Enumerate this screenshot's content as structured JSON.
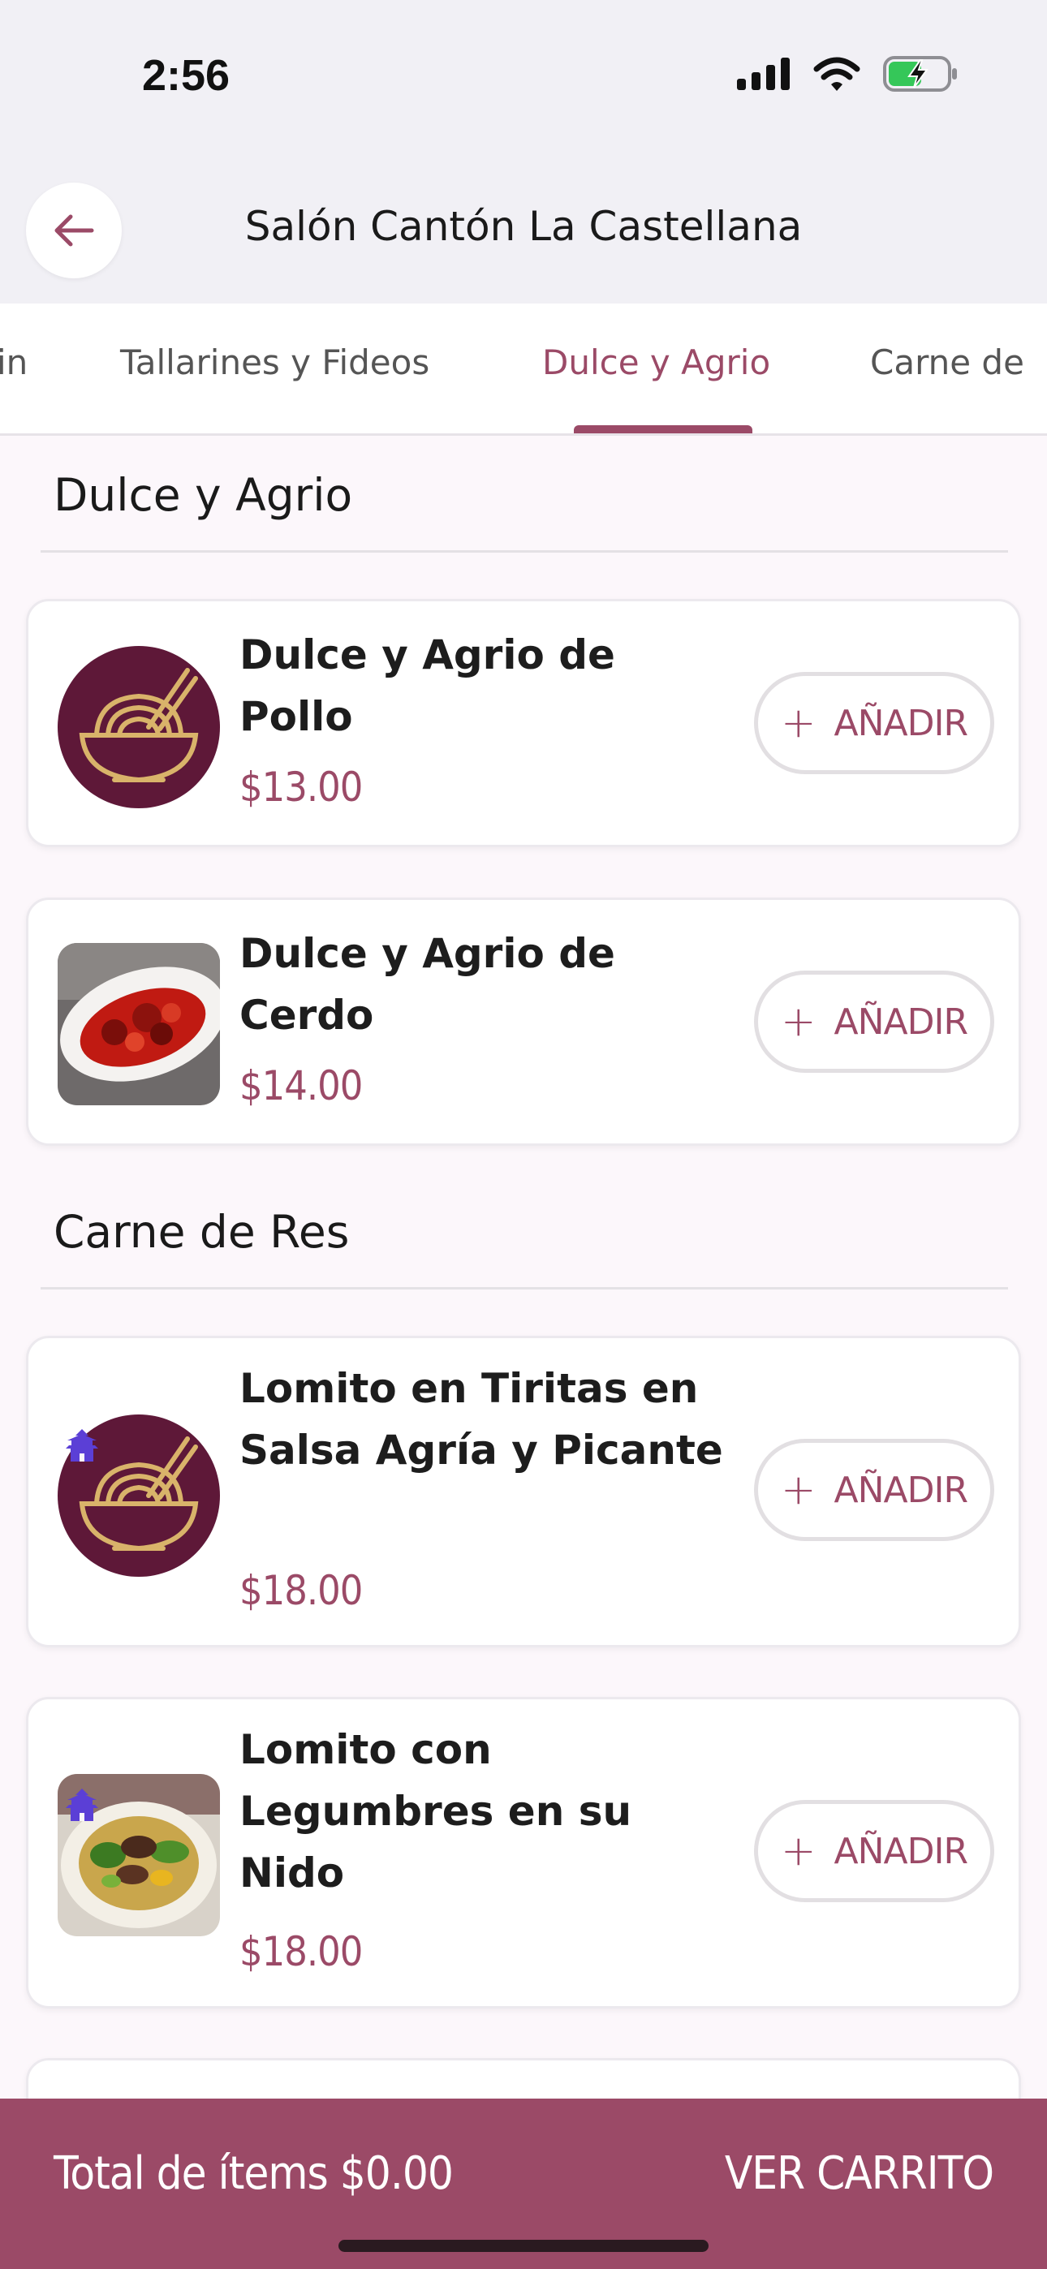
{
  "status_bar": {
    "time": "2:56"
  },
  "header": {
    "title": "Salón Cantón La Castellana"
  },
  "tabs": [
    {
      "label": "in"
    },
    {
      "label": "Tallarines y Fideos"
    },
    {
      "label": "Dulce y Agrio",
      "active": true
    },
    {
      "label": "Carne de"
    }
  ],
  "sections": [
    {
      "title": "Dulce y Agrio",
      "items": [
        {
          "name": "Dulce y Agrio de Pollo",
          "price": "$13.00",
          "image": "noodle-bowl-logo"
        },
        {
          "name": "Dulce y Agrio de Cerdo",
          "price": "$14.00",
          "image": "sweet-sour-pork-photo"
        }
      ]
    },
    {
      "title": "Carne de Res",
      "items": [
        {
          "name": "Lomito en Tiritas en Salsa Agría y Picante",
          "price": "$18.00",
          "image": "noodle-bowl-logo",
          "badge": "pagoda-icon"
        },
        {
          "name": "Lomito con Legumbres en su Nido",
          "price": "$18.00",
          "image": "beef-vegetables-photo",
          "badge": "pagoda-icon"
        }
      ]
    }
  ],
  "add_button": {
    "label": "AÑADIR",
    "icon": "plus-icon"
  },
  "bottom_bar": {
    "total": "Total de ítems $0.00",
    "cart": "VER CARRITO"
  },
  "colors": {
    "accent": "#9b4a67",
    "logo_bg": "#5e1838",
    "logo_line": "#d9b36a",
    "badge": "#5b3fd6"
  }
}
